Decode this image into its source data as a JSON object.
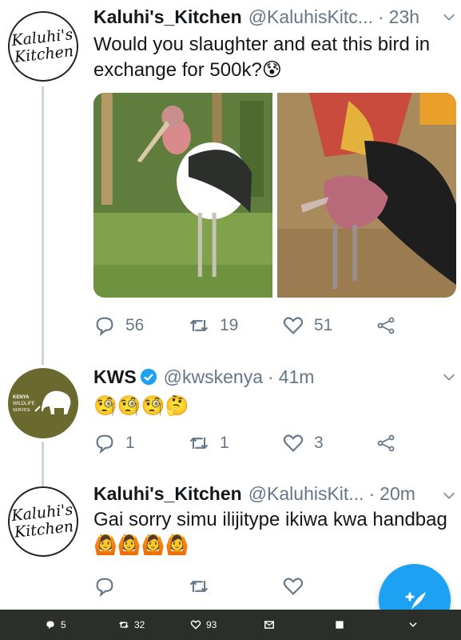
{
  "tweets": [
    {
      "name": "Kaluhi's_Kitchen",
      "handle": "@KaluhisKitc...",
      "dot": "·",
      "time": "23h",
      "text": "Would you slaughter and eat this bird in exchange for 500k?😰",
      "avatar_text": "Kaluhi's Kitchen",
      "replies": "56",
      "retweets": "19",
      "likes": "51"
    },
    {
      "name": "KWS",
      "handle": "@kwskenya",
      "dot": "·",
      "time": "41m",
      "text": "🧐🧐🧐🤔",
      "avatar_text": "KENYA WILDLIFE SERVICE",
      "replies": "1",
      "retweets": "1",
      "likes": "3",
      "verified": true
    },
    {
      "name": "Kaluhi's_Kitchen",
      "handle": "@KaluhisKit...",
      "dot": "·",
      "time": "20m",
      "text": "Gai sorry simu ilijitype ikiwa kwa handbag 🙆🙆🙆🙆",
      "avatar_text": "Kaluhi's Kitchen",
      "replies": "",
      "retweets": "",
      "likes": ""
    }
  ],
  "status_bar": {
    "comments": "5",
    "retweets": "32",
    "likes": "93"
  },
  "colors": {
    "accent": "#1da1f2",
    "muted": "#657786",
    "kws_green": "#6b6a2e",
    "sysbar": "#2b2f2b"
  },
  "icons": [
    "reply-icon",
    "retweet-icon",
    "like-icon",
    "share-icon",
    "chevron-down-icon",
    "verified-icon",
    "compose-icon",
    "mail-icon"
  ]
}
